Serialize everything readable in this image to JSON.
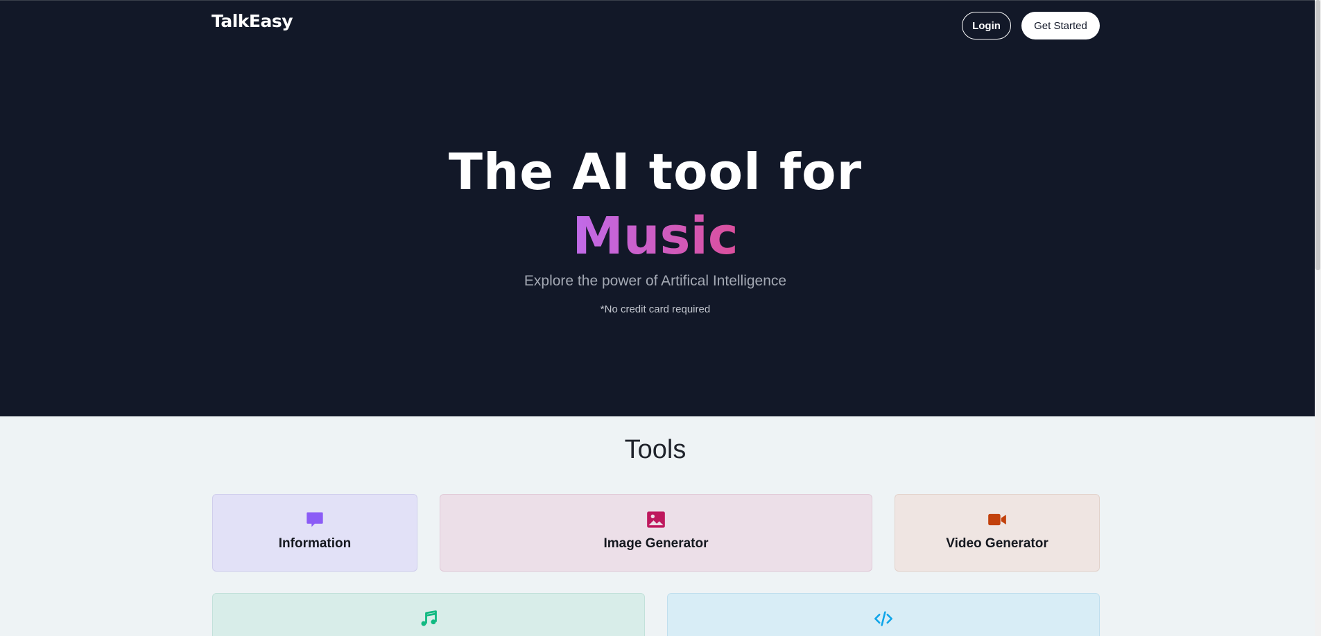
{
  "header": {
    "logo": "TalkEasy",
    "login_label": "Login",
    "get_started_label": "Get Started"
  },
  "hero": {
    "title": "The AI tool for",
    "highlight_word": "Music",
    "subtitle": "Explore the power of Artifical Intelligence",
    "note": "*No credit card required"
  },
  "tools": {
    "title": "Tools",
    "items": [
      {
        "label": "Information",
        "icon": "chat-bubble-icon",
        "color": "#8b5cf6"
      },
      {
        "label": "Image Generator",
        "icon": "image-icon",
        "color": "#be185d"
      },
      {
        "label": "Video Generator",
        "icon": "video-camera-icon",
        "color": "#c2410c"
      },
      {
        "label": "",
        "icon": "music-note-icon",
        "color": "#10b981"
      },
      {
        "label": "",
        "icon": "code-icon",
        "color": "#0ea5e9"
      }
    ]
  },
  "colors": {
    "hero_bg": "#121828",
    "highlight_gradient_start": "#c06bea",
    "highlight_gradient_end": "#db4f9c"
  }
}
